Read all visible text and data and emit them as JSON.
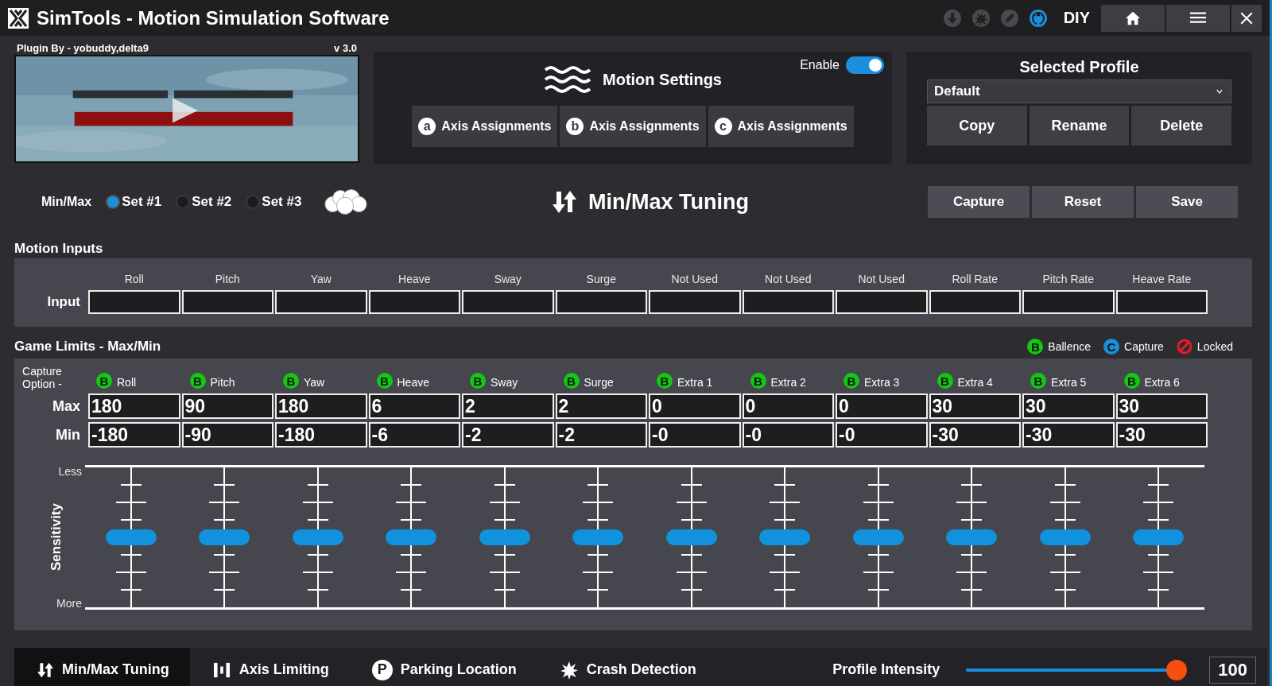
{
  "title_bar": {
    "app_title": "SimTools - Motion Simulation Software",
    "mode": "DIY"
  },
  "plugin": {
    "author": "Plugin By - yobuddy,delta9",
    "version": "v 3.0"
  },
  "motion_settings": {
    "title": "Motion Settings",
    "enable_label": "Enable",
    "enabled": true,
    "axis_buttons": [
      {
        "badge": "a",
        "label": "Axis Assignments"
      },
      {
        "badge": "b",
        "label": "Axis Assignments"
      },
      {
        "badge": "c",
        "label": "Axis Assignments"
      }
    ]
  },
  "selected_profile": {
    "title": "Selected Profile",
    "value": "Default",
    "buttons": [
      "Copy",
      "Rename",
      "Delete"
    ]
  },
  "minmax": {
    "label": "Min/Max",
    "sets": [
      {
        "label": "Set #1",
        "selected": true
      },
      {
        "label": "Set #2",
        "selected": false
      },
      {
        "label": "Set #3",
        "selected": false
      }
    ]
  },
  "tuning": {
    "title": "Min/Max Tuning",
    "buttons": [
      "Capture",
      "Reset",
      "Save"
    ]
  },
  "motion_inputs": {
    "title": "Motion Inputs",
    "row_label": "Input",
    "columns": [
      "Roll",
      "Pitch",
      "Yaw",
      "Heave",
      "Sway",
      "Surge",
      "Not Used",
      "Not Used",
      "Not Used",
      "Roll Rate",
      "Pitch Rate",
      "Heave Rate"
    ]
  },
  "game_limits": {
    "title": "Game Limits - Max/Min",
    "capture_label": "Capture Option -",
    "max_label": "Max",
    "min_label": "Min",
    "less_label": "Less",
    "more_label": "More",
    "axis_title": "Sensitivity",
    "legend": [
      {
        "badge": "B",
        "label": "Ballence",
        "color": "#13c713"
      },
      {
        "badge": "C",
        "label": "Capture",
        "color": "#1a8fdc"
      },
      {
        "label": "Locked",
        "color": "#e81c24",
        "kind": "locked"
      }
    ],
    "axes": [
      {
        "badge": "B",
        "name": "Roll",
        "max": "180",
        "min": "-180",
        "level": 0.5
      },
      {
        "badge": "B",
        "name": "Pitch",
        "max": "90",
        "min": "-90",
        "level": 0.5
      },
      {
        "badge": "B",
        "name": "Yaw",
        "max": "180",
        "min": "-180",
        "level": 0.5
      },
      {
        "badge": "B",
        "name": "Heave",
        "max": "6",
        "min": "-6",
        "level": 0.5
      },
      {
        "badge": "B",
        "name": "Sway",
        "max": "2",
        "min": "-2",
        "level": 0.5
      },
      {
        "badge": "B",
        "name": "Surge",
        "max": "2",
        "min": "-2",
        "level": 0.5
      },
      {
        "badge": "B",
        "name": "Extra 1",
        "max": "0",
        "min": "-0",
        "level": 0.5
      },
      {
        "badge": "B",
        "name": "Extra 2",
        "max": "0",
        "min": "-0",
        "level": 0.5
      },
      {
        "badge": "B",
        "name": "Extra 3",
        "max": "0",
        "min": "-0",
        "level": 0.5
      },
      {
        "badge": "B",
        "name": "Extra 4",
        "max": "30",
        "min": "-30",
        "level": 0.5
      },
      {
        "badge": "B",
        "name": "Extra 5",
        "max": "30",
        "min": "-30",
        "level": 0.5
      },
      {
        "badge": "B",
        "name": "Extra 6",
        "max": "30",
        "min": "-30",
        "level": 0.5
      }
    ]
  },
  "bottom_tabs": [
    {
      "kind": "updown",
      "label": "Min/Max Tuning",
      "selected": true
    },
    {
      "kind": "bars",
      "label": "Axis Limiting",
      "selected": false
    },
    {
      "kind": "parking",
      "badge": "P",
      "label": "Parking Location",
      "selected": false
    },
    {
      "kind": "crash",
      "label": "Crash Detection",
      "selected": false
    }
  ],
  "profile_intensity": {
    "label": "Profile Intensity",
    "level": 1,
    "value": "100"
  }
}
